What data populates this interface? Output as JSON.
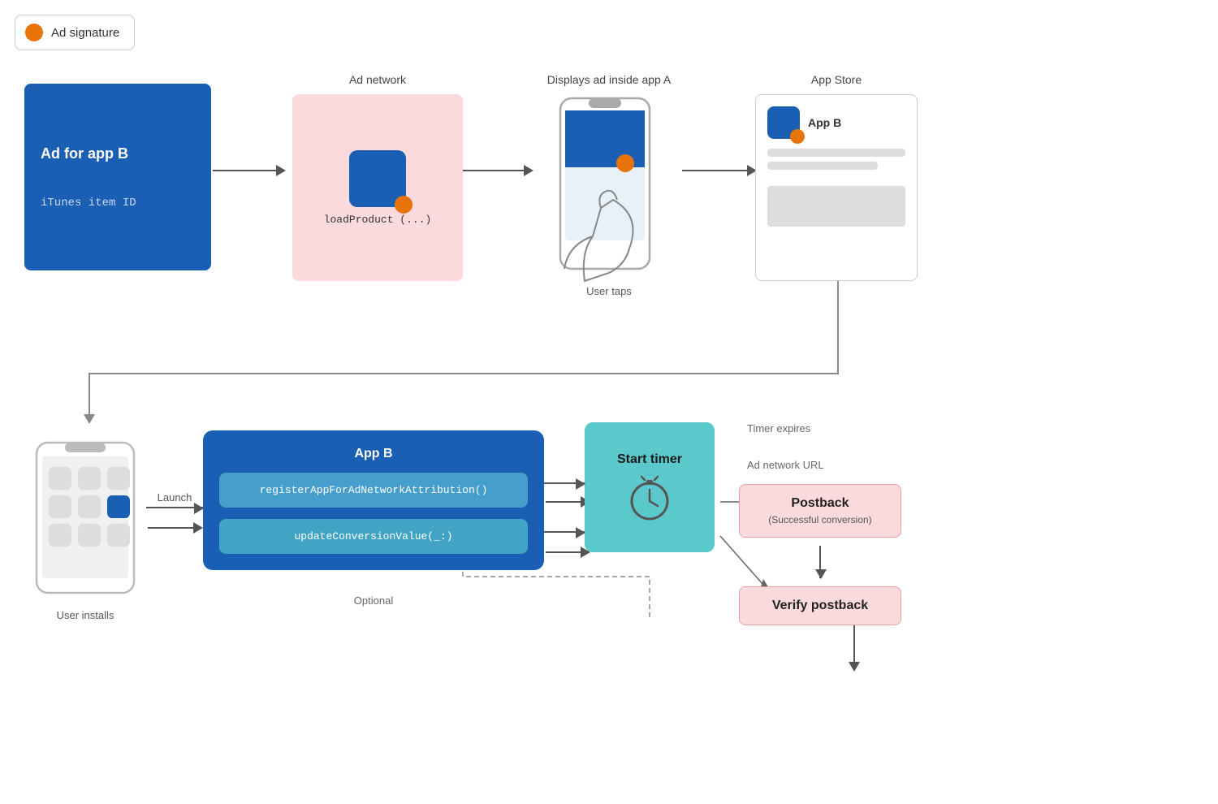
{
  "legend": {
    "dot_color": "#e8730a",
    "label": "Ad signature"
  },
  "top_row": {
    "ad_box": {
      "title": "Ad for app B",
      "subtitle": "iTunes item ID"
    },
    "col_labels": {
      "ad_network": "Ad network",
      "displays_ad": "Displays ad inside app A",
      "app_store": "App Store"
    },
    "network_box": {
      "code": "loadProduct (...)"
    },
    "phone_label": "User taps",
    "app_b_label": "App B"
  },
  "bottom_row": {
    "user_installs": "User installs",
    "launch_label": "Launch",
    "app_b_title": "App B",
    "func1": "registerAppForAdNetworkAttribution()",
    "func2": "updateConversionValue(_:)",
    "optional_label": "Optional",
    "timer_label": "Start timer",
    "timer_expires": "Timer expires",
    "ad_network_url": "Ad network URL",
    "postback_title": "Postback",
    "postback_sub": "(Successful conversion)",
    "verify_title": "Verify postback"
  }
}
